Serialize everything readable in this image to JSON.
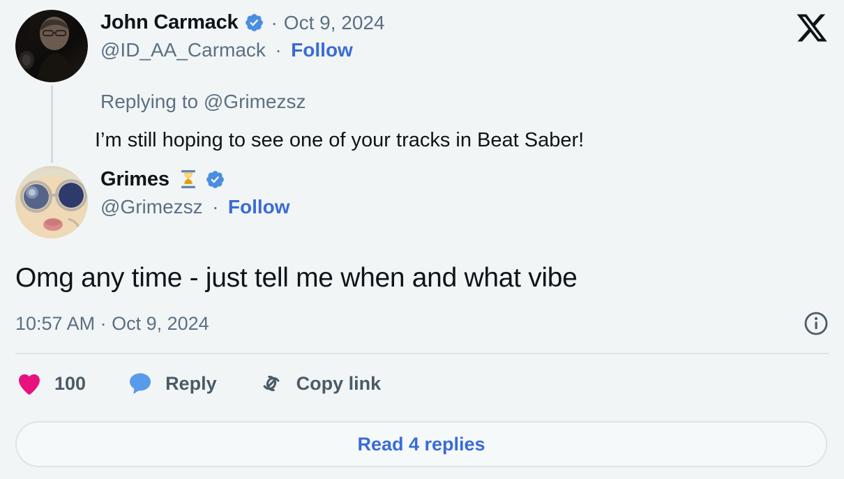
{
  "platform": {
    "name": "X",
    "logo_icon": "x-logo"
  },
  "parent_tweet": {
    "author": {
      "display_name": "John Carmack",
      "handle": "@ID_AA_Carmack",
      "verified": true,
      "verified_icon": "verified-badge-icon",
      "avatar_alt": "John Carmack profile photo"
    },
    "timestamp": "Oct 9, 2024",
    "separator": "·",
    "follow_label": "Follow",
    "replying_to": "Replying to @Grimezsz",
    "text": "I’m still hoping to see one of your tracks in Beat Saber!"
  },
  "main_tweet": {
    "author": {
      "display_name": "Grimes",
      "name_emoji": "⌛",
      "handle": "@Grimezsz",
      "verified": true,
      "verified_icon": "verified-badge-icon",
      "avatar_alt": "Grimes profile photo"
    },
    "separator": "·",
    "follow_label": "Follow",
    "text": "Omg any time - just tell me when and what vibe",
    "meta": {
      "time": "10:57 AM",
      "separator": "·",
      "date": "Oct 9, 2024",
      "info_icon": "info-circle-icon"
    }
  },
  "actions": {
    "like": {
      "icon": "heart-icon",
      "count": "100"
    },
    "reply": {
      "icon": "speech-bubble-icon",
      "label": "Reply"
    },
    "copy_link": {
      "icon": "link-icon",
      "label": "Copy link"
    }
  },
  "footer": {
    "read_replies_label": "Read 4 replies"
  },
  "colors": {
    "background": "#f2f5f6",
    "text_primary": "#0f1419",
    "text_secondary": "#5b7083",
    "link_blue": "#3a6bd6",
    "verified_blue": "#4a8ee0",
    "heart_pink": "#e8127f",
    "reply_blue": "#5a9aea",
    "icon_gray": "#4c5b66",
    "divider": "#dfe3e5"
  }
}
